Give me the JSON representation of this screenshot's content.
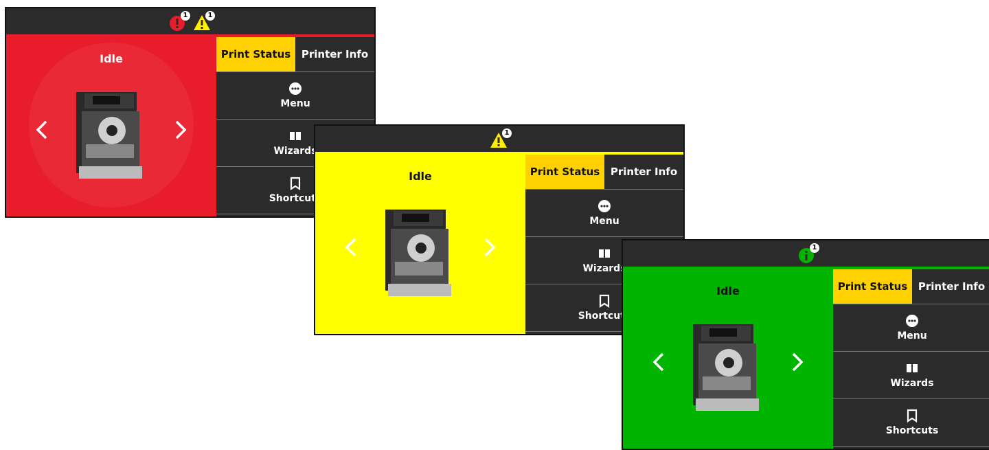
{
  "screens": [
    {
      "status_text": "Idle",
      "tabs": [
        "Print Status",
        "Printer Info"
      ],
      "menu_items": [
        "Menu",
        "Wizards",
        "Shortcuts"
      ],
      "bg_color": "#e81c2a",
      "alerts": [
        {
          "type": "error",
          "count": "1"
        },
        {
          "type": "warning",
          "count": "1"
        }
      ]
    },
    {
      "status_text": "Idle",
      "tabs": [
        "Print Status",
        "Printer Info"
      ],
      "menu_items": [
        "Menu",
        "Wizards",
        "Shortcuts"
      ],
      "bg_color": "#ffff00",
      "alerts": [
        {
          "type": "warning",
          "count": "1"
        }
      ]
    },
    {
      "status_text": "Idle",
      "tabs": [
        "Print Status",
        "Printer Info"
      ],
      "menu_items": [
        "Menu",
        "Wizards",
        "Shortcuts"
      ],
      "bg_color": "#00b400",
      "alerts": [
        {
          "type": "info",
          "count": "1"
        }
      ]
    }
  ]
}
